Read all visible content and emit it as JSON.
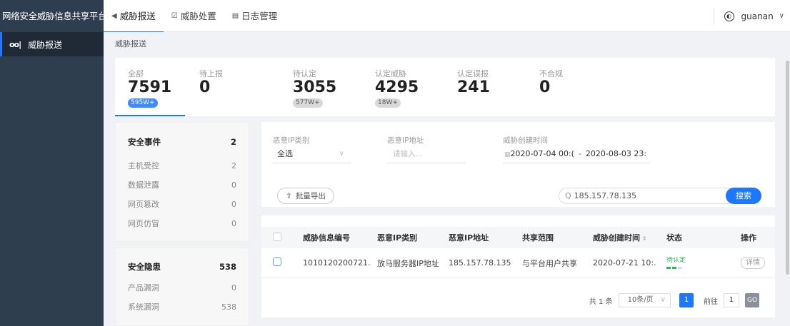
{
  "header": {
    "brand": "网络安全威胁信息共享平台",
    "nav": [
      {
        "icon": "◀",
        "label": "威胁报送"
      },
      {
        "icon": "☑",
        "label": "威胁处置"
      },
      {
        "icon": "▤",
        "label": "日志管理"
      }
    ],
    "user": {
      "name": "guanan",
      "icon": "◐",
      "chevron": "∨"
    }
  },
  "sidebar": {
    "items": [
      {
        "icon": "oo|",
        "label": "威胁报送"
      }
    ]
  },
  "breadcrumb": "威胁报送",
  "stats": [
    {
      "label": "全部",
      "value": "7591",
      "badge": "595W+"
    },
    {
      "label": "待上报",
      "value": "0",
      "badge": ""
    },
    {
      "label": "待认定",
      "value": "3055",
      "badge": "577W+"
    },
    {
      "label": "认定威胁",
      "value": "4295",
      "badge": "18W+"
    },
    {
      "label": "认定误报",
      "value": "241",
      "badge": ""
    },
    {
      "label": "不合规",
      "value": "0",
      "badge": ""
    }
  ],
  "events_panel": {
    "title": "安全事件",
    "count": "2",
    "rows": [
      {
        "label": "主机受控",
        "count": "2"
      },
      {
        "label": "数据泄露",
        "count": "0"
      },
      {
        "label": "网页篡改",
        "count": "0"
      },
      {
        "label": "网页仿冒",
        "count": "0"
      }
    ]
  },
  "hazards_panel": {
    "title": "安全隐患",
    "count": "538",
    "rows": [
      {
        "label": "产品漏洞",
        "count": "0"
      },
      {
        "label": "系统漏洞",
        "count": "538"
      }
    ]
  },
  "filters": {
    "ip_type": {
      "label": "恶意IP类别",
      "value": "全选",
      "chevron": "∨"
    },
    "ip_addr": {
      "label": "恶意IP地址",
      "placeholder": "请输入..."
    },
    "created": {
      "label": "威胁创建时间",
      "start": "2020-07-04 00:(",
      "sep": "-",
      "end": "2020-08-03 23:",
      "icon": "▦"
    }
  },
  "toolbar": {
    "export_icon": "⇧",
    "export_label": "批量导出",
    "search_icon": "Q",
    "search_value": "185.157.78.135",
    "search_label": "搜索"
  },
  "table": {
    "columns": [
      "威胁信息编号",
      "恶意IP类别",
      "恶意IP地址",
      "共享范围",
      "威胁创建时间",
      "状态",
      "操作"
    ],
    "sort_icon": "⇕",
    "rows": [
      {
        "id": "1010120200721...",
        "ip_type": "放马服务器IP地址",
        "ip": "185.157.78.135",
        "scope": "与平台用户共享",
        "created": "2020-07-21 10:...",
        "status": "待认定",
        "status_progress": 0.67,
        "action": "详情"
      }
    ]
  },
  "pagination": {
    "total": "共 1 条",
    "page_size": "10条/页",
    "chevron": "∨",
    "current": "1",
    "goto_label": "前往",
    "goto_value": "1",
    "go": "GO"
  },
  "colors": {
    "accent": "#1e78ff",
    "sidebar": "#2f3e4e",
    "status": "#2db55d"
  }
}
